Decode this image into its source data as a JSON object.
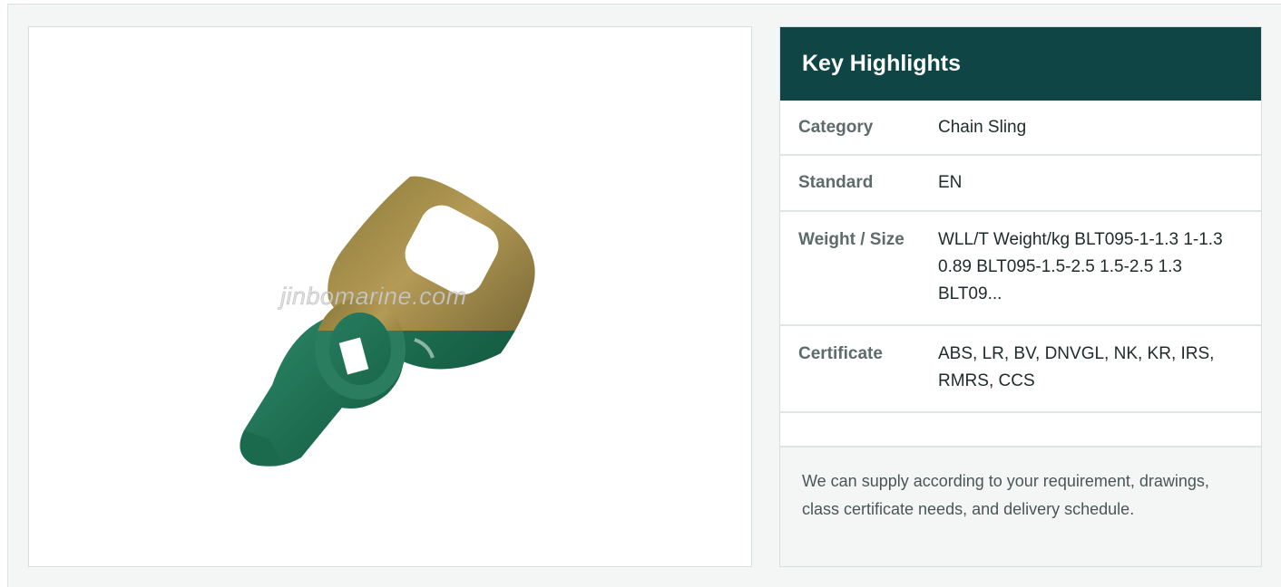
{
  "product_image": {
    "watermark": "jinbomarine.com",
    "icon": "fitting-product-image"
  },
  "highlights": {
    "title": "Key Highlights",
    "rows": [
      {
        "label": "Category",
        "value": "Chain Sling"
      },
      {
        "label": "Standard",
        "value": "EN"
      },
      {
        "label": "Weight / Size",
        "value": "WLL/T Weight/kg BLT095-1-1.3 1-1.3 0.89 BLT095-1.5-2.5 1.5-2.5 1.3 BLT09..."
      },
      {
        "label": "Certificate",
        "value": "ABS, LR, BV, DNVGL, NK, KR, IRS, RMRS, CCS"
      },
      {
        "label": "",
        "value": ""
      }
    ],
    "note": "We can supply according to your requirement, drawings, class certificate needs, and delivery schedule."
  },
  "colors": {
    "header_bg": "#0f4545",
    "panel_border": "#d7dfdf",
    "frame_bg": "#f4f6f6"
  }
}
